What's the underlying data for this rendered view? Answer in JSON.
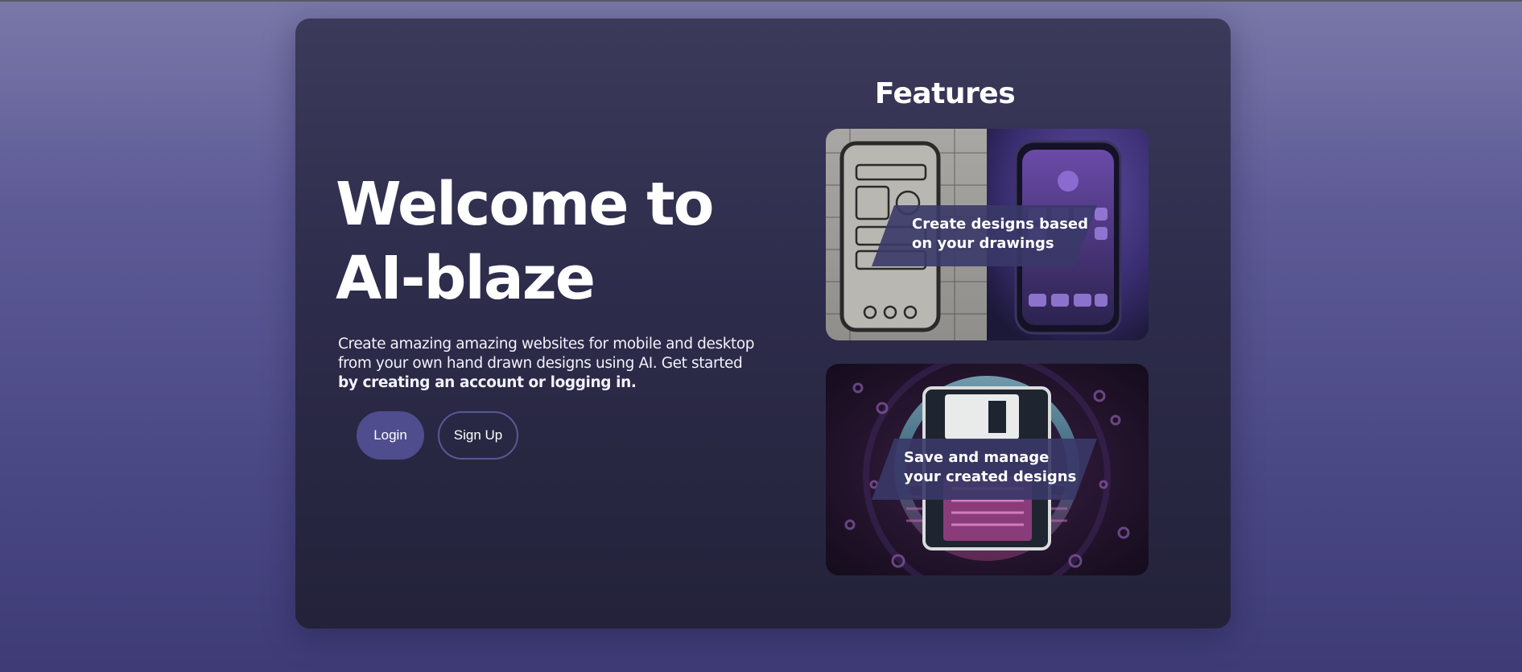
{
  "hero": {
    "title_line1": "Welcome to",
    "title_line2": "AI-blaze",
    "description": "Create amazing amazing websites for mobile and desktop from your own hand drawn designs using AI. Get started",
    "description_bold": "by creating an account or logging in."
  },
  "buttons": {
    "login_label": "Login",
    "signup_label": "Sign Up"
  },
  "features": {
    "title": "Features",
    "items": [
      {
        "caption_line1": "Create designs based",
        "caption_line2": "on your drawings",
        "icon": "sketch-to-phone-image"
      },
      {
        "caption_line1": "Save and manage",
        "caption_line2": "your created designs",
        "icon": "floppy-disk-image"
      }
    ]
  },
  "colors": {
    "page_background": "#5e5b97",
    "card_background": "#2d2c4b",
    "login_button": "#4f4d8e",
    "signup_border": "#5a5894",
    "caption_background": "#3a3868"
  }
}
